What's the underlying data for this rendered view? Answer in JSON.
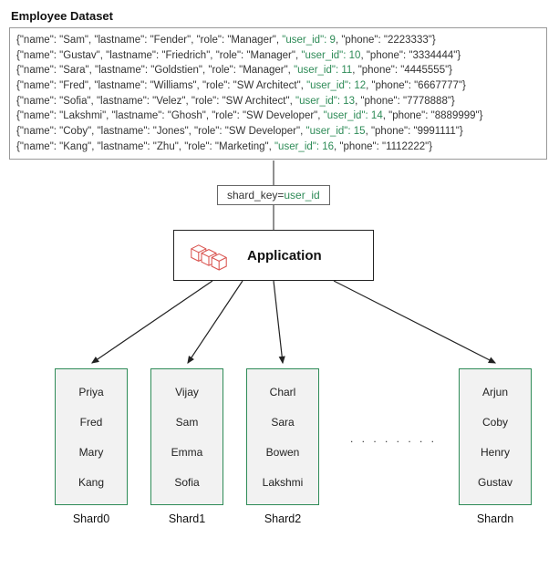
{
  "title": "Employee Dataset",
  "dataset": [
    {
      "name": "Sam",
      "lastname": "Fender",
      "role": "Manager",
      "user_id": 9,
      "phone": "2223333"
    },
    {
      "name": "Gustav",
      "lastname": "Friedrich",
      "role": "Manager",
      "user_id": 10,
      "phone": "3334444"
    },
    {
      "name": "Sara",
      "lastname": "Goldstien",
      "role": "Manager",
      "user_id": 11,
      "phone": "4445555"
    },
    {
      "name": "Fred",
      "lastname": "Williams",
      "role": "SW Architect",
      "user_id": 12,
      "phone": "6667777"
    },
    {
      "name": "Sofia",
      "lastname": "Velez",
      "role": "SW Architect",
      "user_id": 13,
      "phone": "7778888"
    },
    {
      "name": "Lakshmi",
      "lastname": "Ghosh",
      "role": "SW Developer",
      "user_id": 14,
      "phone": "8889999"
    },
    {
      "name": "Coby",
      "lastname": "Jones",
      "role": "SW Developer",
      "user_id": 15,
      "phone": "9991111"
    },
    {
      "name": "Kang",
      "lastname": "Zhu",
      "role": "Marketing",
      "user_id": 16,
      "phone": "1112222"
    }
  ],
  "shardkey_label_prefix": "shard_key=",
  "shardkey_value": "user_id",
  "app_label": "Application",
  "shards": [
    {
      "label": "Shard0",
      "items": [
        "Priya",
        "Fred",
        "Mary",
        "Kang"
      ]
    },
    {
      "label": "Shard1",
      "items": [
        "Vijay",
        "Sam",
        "Emma",
        "Sofia"
      ]
    },
    {
      "label": "Shard2",
      "items": [
        "Charl",
        "Sara",
        "Bowen",
        "Lakshmi"
      ]
    },
    {
      "label": "Shardn",
      "items": [
        "Arjun",
        "Coby",
        "Henry",
        "Gustav"
      ]
    }
  ],
  "ellipsis": ". . . . . . . .",
  "chart_data": {
    "type": "diagram",
    "title": "Employee Dataset Sharding",
    "flow": [
      "Employee Dataset",
      "shard_key=user_id",
      "Application",
      "Shards"
    ],
    "shard_key": "user_id",
    "records": [
      {
        "name": "Sam",
        "lastname": "Fender",
        "role": "Manager",
        "user_id": 9,
        "phone": "2223333"
      },
      {
        "name": "Gustav",
        "lastname": "Friedrich",
        "role": "Manager",
        "user_id": 10,
        "phone": "3334444"
      },
      {
        "name": "Sara",
        "lastname": "Goldstien",
        "role": "Manager",
        "user_id": 11,
        "phone": "4445555"
      },
      {
        "name": "Fred",
        "lastname": "Williams",
        "role": "SW Architect",
        "user_id": 12,
        "phone": "6667777"
      },
      {
        "name": "Sofia",
        "lastname": "Velez",
        "role": "SW Architect",
        "user_id": 13,
        "phone": "7778888"
      },
      {
        "name": "Lakshmi",
        "lastname": "Ghosh",
        "role": "SW Developer",
        "user_id": 14,
        "phone": "8889999"
      },
      {
        "name": "Coby",
        "lastname": "Jones",
        "role": "SW Developer",
        "user_id": 15,
        "phone": "9991111"
      },
      {
        "name": "Kang",
        "lastname": "Zhu",
        "role": "Marketing",
        "user_id": 16,
        "phone": "1112222"
      }
    ],
    "shards": {
      "Shard0": [
        "Priya",
        "Fred",
        "Mary",
        "Kang"
      ],
      "Shard1": [
        "Vijay",
        "Sam",
        "Emma",
        "Sofia"
      ],
      "Shard2": [
        "Charl",
        "Sara",
        "Bowen",
        "Lakshmi"
      ],
      "Shardn": [
        "Arjun",
        "Coby",
        "Henry",
        "Gustav"
      ]
    }
  }
}
